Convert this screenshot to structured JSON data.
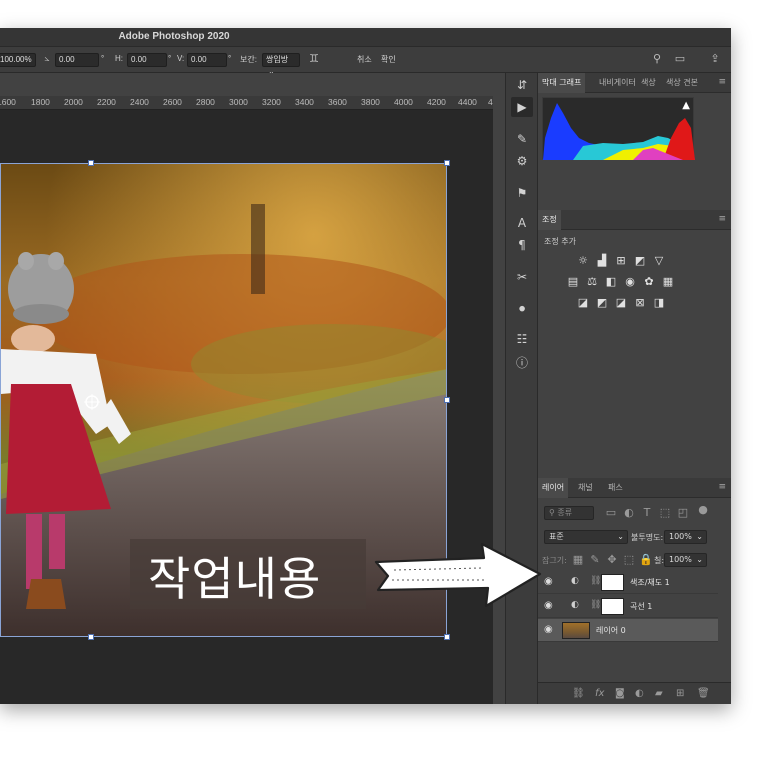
{
  "window": {
    "title": "Adobe Photoshop 2020"
  },
  "options_bar": {
    "w_value": "100.00%",
    "angle_value": "0.00",
    "h_label": "H:",
    "h_value": "0.00",
    "v_label": "V:",
    "v_value": "0.00",
    "degree_mark": "°",
    "interp_label": "보간:",
    "interp_value": "쌍입방",
    "cancel_label": "취소",
    "confirm_label": "확인"
  },
  "ruler": {
    "ticks": [
      "1600",
      "1800",
      "2000",
      "2200",
      "2400",
      "2600",
      "2800",
      "3000",
      "3200",
      "3400",
      "3600",
      "3800",
      "4000",
      "4200",
      "4400",
      "4"
    ]
  },
  "canvas": {
    "overlay_text": "작업내용"
  },
  "histogram_panel": {
    "tabs": [
      "막대 그래프",
      "내비게이터",
      "색상",
      "색상 견본"
    ],
    "warning_icon": "warning-icon"
  },
  "adjustments_panel": {
    "tab": "조정",
    "add_label": "조정 추가"
  },
  "layers_panel": {
    "tabs": [
      "레이어",
      "채널",
      "패스"
    ],
    "search_placeholder": "종류",
    "blend_mode": "표준",
    "opacity_label": "불투명도:",
    "opacity_value": "100%",
    "lock_label": "잠그기:",
    "fill_label": "칠:",
    "fill_value": "100%",
    "layers": [
      {
        "name": "색조/채도 1"
      },
      {
        "name": "곡선 1"
      },
      {
        "name": "레이어 0"
      }
    ]
  },
  "colors": {
    "accent": "#4d6fb3",
    "panel_bg": "#424242",
    "selected_layer": "#5a5a5a"
  }
}
